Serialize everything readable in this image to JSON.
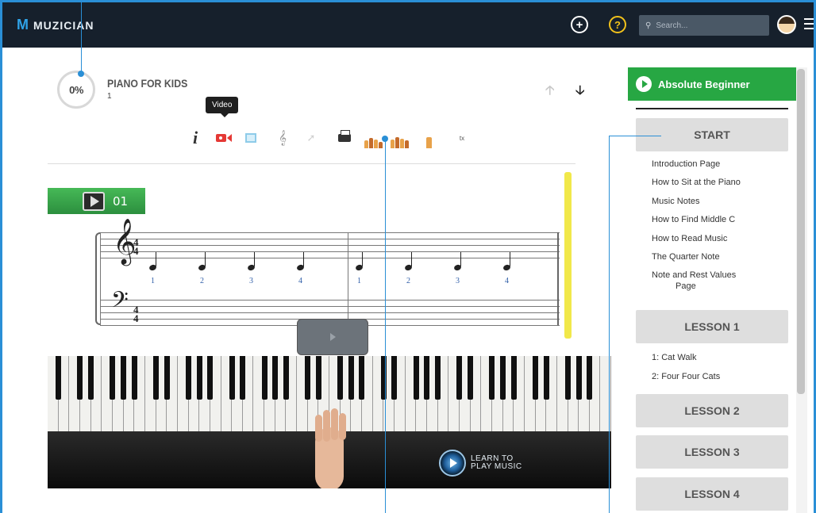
{
  "app": {
    "logo_letter": "M",
    "name": "MUZICIAN"
  },
  "topbar": {
    "search_placeholder": "Search..."
  },
  "course": {
    "progress": "0%",
    "title": "PIANO FOR KIDS",
    "subtitle": "1"
  },
  "tooltip": "Video",
  "toolbar": {
    "info": "i",
    "tx": "tx"
  },
  "score": {
    "tab_number": "01",
    "counts": [
      "1",
      "2",
      "3",
      "4",
      "1",
      "2",
      "3",
      "4"
    ]
  },
  "video": {
    "watermark_line1": "LEARN TO",
    "watermark_line2": "PLAY MUSIC"
  },
  "sidebar": {
    "level": "Absolute Beginner",
    "start": "START",
    "start_items": [
      "Introduction Page",
      "How to Sit at the Piano",
      "Music Notes",
      "How to Find Middle C",
      "How to Read Music",
      "The Quarter Note",
      "Note and Rest Values",
      "Page"
    ],
    "lesson1": "LESSON 1",
    "lesson1_items": [
      "1: Cat Walk",
      "2: Four Four Cats"
    ],
    "lesson2": "LESSON 2",
    "lesson3": "LESSON 3",
    "lesson4": "LESSON 4"
  },
  "colors": {
    "accent_green": "#27a743",
    "frame_blue": "#2a8fd6",
    "topbar": "#16202c",
    "video_red": "#e53935"
  }
}
